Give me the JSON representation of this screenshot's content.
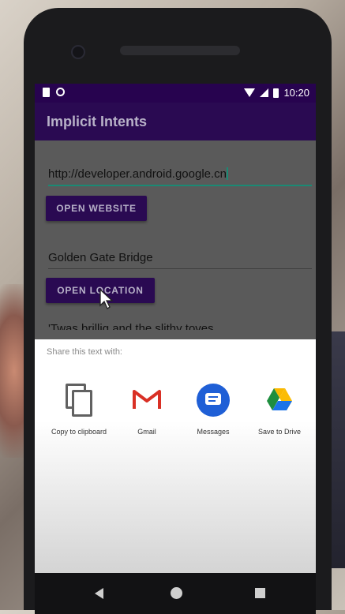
{
  "status_bar": {
    "time": "10:20"
  },
  "app_bar": {
    "title": "Implicit Intents"
  },
  "website_field": {
    "value": "http://developer.android.google.cn"
  },
  "open_website_button": {
    "label": "OPEN WEBSITE"
  },
  "location_field": {
    "value": "Golden Gate Bridge"
  },
  "open_location_button": {
    "label": "OPEN LOCATION"
  },
  "share_text_partial": "'Twas brillig and the slithy toves",
  "share_sheet": {
    "title": "Share this text with:",
    "items": [
      {
        "label": "Copy to clipboard",
        "icon": "copy-icon"
      },
      {
        "label": "Gmail",
        "icon": "gmail-icon"
      },
      {
        "label": "Messages",
        "icon": "messages-icon"
      },
      {
        "label": "Save to Drive",
        "icon": "drive-icon"
      }
    ]
  },
  "colors": {
    "primary": "#2a0a52",
    "status_bar": "#27034f",
    "accent_underline": "#1a8a74"
  }
}
